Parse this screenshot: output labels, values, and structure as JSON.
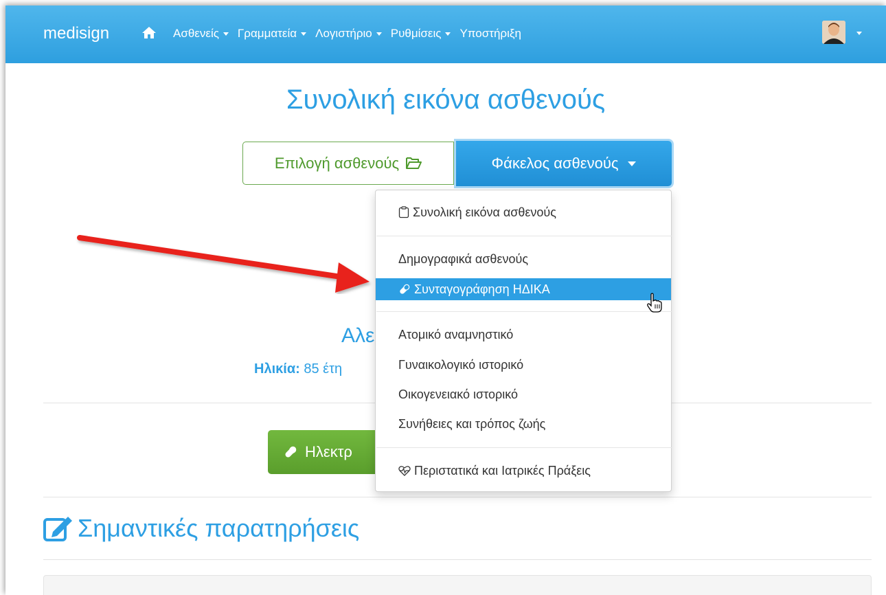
{
  "navbar": {
    "brand": "medisign",
    "items": [
      {
        "label": "Ασθενείς",
        "has_caret": true
      },
      {
        "label": "Γραμματεία",
        "has_caret": true
      },
      {
        "label": "Λογιστήριο",
        "has_caret": true
      },
      {
        "label": "Ρυθμίσεις",
        "has_caret": true
      },
      {
        "label": "Υποστήριξη",
        "has_caret": false
      }
    ],
    "home_icon": "home-icon",
    "avatar_icon": "user-avatar"
  },
  "page": {
    "title": "Συνολική εικόνα ασθενούς",
    "select_patient_label": "Επιλογή ασθενούς",
    "patient_folder_label": "Φάκελος ασθενούς"
  },
  "dropdown": {
    "items": [
      {
        "label": "Συνολική εικόνα ασθενούς",
        "icon": "clipboard-icon"
      },
      {
        "label": "Δημογραφικά ασθενούς",
        "icon": ""
      },
      {
        "label": "Συνταγογράφηση ΗΔΙΚΑ",
        "icon": "pill-icon",
        "active": true
      },
      {
        "label": "Ατομικό αναμνηστικό",
        "icon": ""
      },
      {
        "label": "Γυναικολογικό ιστορικό",
        "icon": ""
      },
      {
        "label": "Οικογενειακό ιστορικό",
        "icon": ""
      },
      {
        "label": "Συνήθειες και τρόπος ζωής",
        "icon": ""
      },
      {
        "label": "Περιστατικά και Ιατρικές Πράξεις",
        "icon": "heartbeat-icon"
      }
    ]
  },
  "patient": {
    "name_partial": "Αλε",
    "age_label": "Ηλικία:",
    "age_value_partial": "85 έτη"
  },
  "actions": {
    "eprescription_partial": "Ηλεκτρ"
  },
  "notes": {
    "title": "Σημαντικές παρατηρήσεις"
  },
  "colors": {
    "primary": "#2d9fe3",
    "success": "#5a9e2c",
    "annotation_arrow": "#e8231c"
  }
}
